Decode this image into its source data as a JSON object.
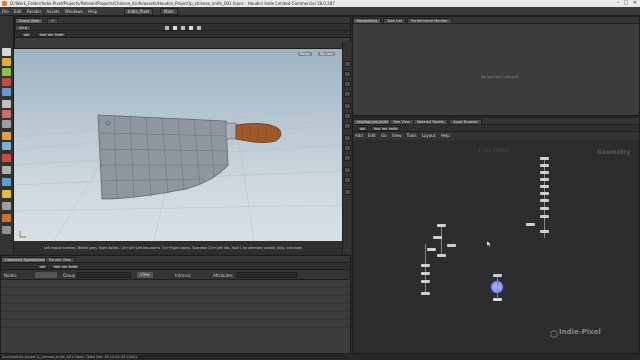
{
  "window": {
    "title": "D:/Work_Folder/Indie-Pixel/Projects/Patreon/Projects/Chinese_Knife/assets/Houdini_Project/p_chinese_knife_001.hipnc - Houdini Indie Limited-Commercial 18.0.287",
    "controls": [
      "–",
      "□",
      "✕"
    ]
  },
  "menubar": {
    "items": [
      "File",
      "Edit",
      "Render",
      "Assets",
      "Windows",
      "Help"
    ],
    "desktops": [
      "Indie_Pixel",
      "Main"
    ]
  },
  "left_pane": {
    "tabs": [
      "Scene View",
      "+"
    ],
    "view_tab": "View",
    "path": [
      "obj",
      "low_res_knife"
    ],
    "viewport_labels": [
      "Persp",
      "No cam"
    ],
    "hint": "Left mouse tumbles. Middle pans. Right dollies. Ctrl+Alt+Left box-zooms. Ctrl+Right zooms. Spacebar Ctrl+Left tilts. Hold L for alternate tumble, dolly, and zoom."
  },
  "bottom_left": {
    "tabs": [
      "Geometry Spreadsheet",
      "Render View"
    ],
    "path": [
      "obj",
      "low_res_knife"
    ],
    "columns": [
      "Nodes",
      "Group",
      "View",
      "Intrinsic",
      "Attributes"
    ]
  },
  "right_top": {
    "tabs": [
      "Parameters",
      "Take List",
      "Performance Monitor"
    ],
    "empty": "No operator selected."
  },
  "right_bottom": {
    "tabs": [
      "/obj/low_res_knife",
      "Tree View",
      "Material Palette",
      "Asset Browser"
    ],
    "path": [
      "obj",
      "low_res_knife"
    ],
    "menu": [
      "Add",
      "Edit",
      "Go",
      "View",
      "Tools",
      "Layout",
      "Help"
    ],
    "context_label": "Indie Edition",
    "context_type": "Geometry"
  },
  "watermark": "Indie-Pixel",
  "statusbar": {
    "text": "Successfully saved 'p_chinese_knife_001.hipnc' (Wed Dec 16 14:22:33 2020)"
  },
  "colors": {
    "accent": "#f07a1a",
    "handle": "#9c5a2c",
    "blade": "#8e979f",
    "network_bg": "#2c2c2c"
  }
}
